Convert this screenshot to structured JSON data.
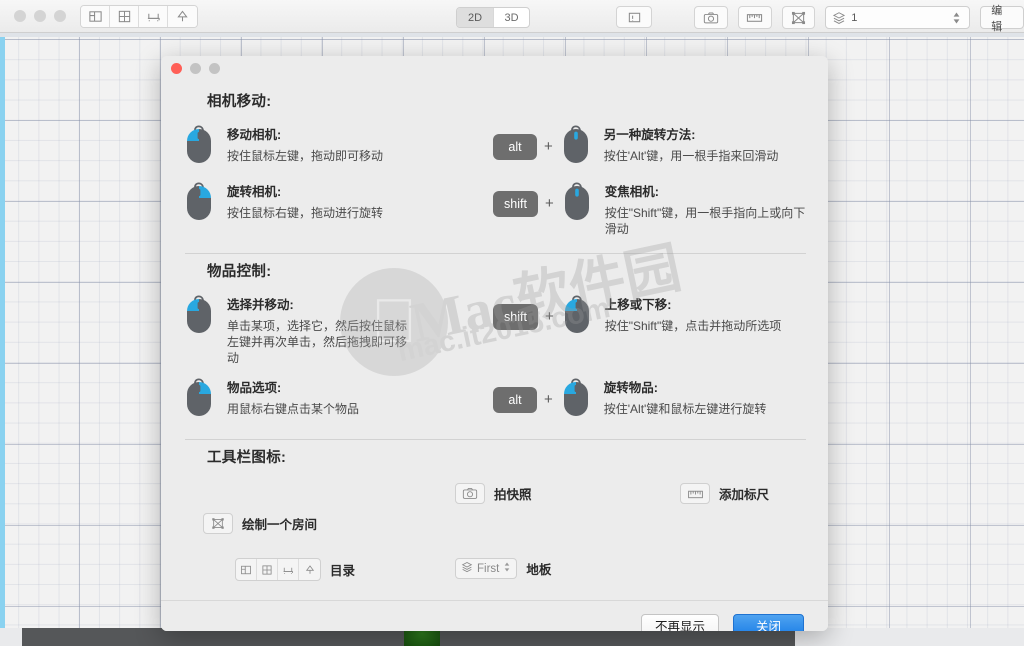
{
  "toolbar": {
    "left_icons": [
      {
        "name": "floorplan-icon",
        "label": "平面图"
      },
      {
        "name": "window-grid-icon",
        "label": "窗户"
      },
      {
        "name": "furniture-icon",
        "label": "家具"
      },
      {
        "name": "tree-icon",
        "label": "植物"
      }
    ],
    "view_modes": [
      {
        "label": "2D",
        "active": true
      },
      {
        "label": "3D",
        "active": false
      }
    ],
    "note_icon": "note-icon",
    "camera_icon": "camera-icon",
    "ruler_icon": "ruler-icon",
    "room-icon": "draw-room-icon",
    "layer_icon": "layers-icon",
    "layer_value": "1",
    "edit_label": "编辑"
  },
  "dialog": {
    "window_dots": [
      "close",
      "minimize",
      "zoom"
    ],
    "sections": [
      {
        "title": "相机移动:",
        "entries": [
          {
            "col": "left",
            "mouse": "left",
            "modifier": null,
            "title": "移动相机:",
            "desc": "按住鼠标左键，拖动即可移动"
          },
          {
            "col": "right",
            "mouse": "wheel",
            "modifier": "alt",
            "title": "另一种旋转方法:",
            "desc": "按住'Alt'键，用一根手指来回滑动"
          },
          {
            "col": "left",
            "mouse": "right",
            "modifier": null,
            "title": "旋转相机:",
            "desc": "按住鼠标右键，拖动进行旋转"
          },
          {
            "col": "right",
            "mouse": "wheel",
            "modifier": "shift",
            "title": "变焦相机:",
            "desc": "按住\"Shift\"键，用一根手指向上或向下滑动"
          }
        ]
      },
      {
        "title": "物品控制:",
        "entries": [
          {
            "col": "left",
            "mouse": "left",
            "modifier": null,
            "title": "选择并移动:",
            "desc": "单击某项，选择它，然后按住鼠标左键并再次单击，然后拖拽即可移动"
          },
          {
            "col": "right",
            "mouse": "left",
            "modifier": "shift",
            "title": "上移或下移:",
            "desc": "按住\"Shift\"键，点击并拖动所选项"
          },
          {
            "col": "left",
            "mouse": "right",
            "modifier": null,
            "title": "物品选项:",
            "desc": "用鼠标右键点击某个物品"
          },
          {
            "col": "right",
            "mouse": "left",
            "modifier": "alt",
            "title": "旋转物品:",
            "desc": "按住'Alt'键和鼠标左键进行旋转"
          }
        ]
      }
    ],
    "toolbar_icons_section": {
      "title": "工具栏图标:",
      "items": [
        {
          "icon": "draw-room-icon",
          "label": "绘制一个房间"
        },
        {
          "icon": "camera-icon",
          "label": "拍快照"
        },
        {
          "icon": "ruler-icon",
          "label": "添加标尺"
        },
        {
          "icon": "catalog-icons",
          "label": "目录"
        },
        {
          "icon": "layers-icon",
          "label": "地板",
          "select_value": "First"
        }
      ]
    },
    "footer": {
      "dont_show_label": "不再显示",
      "close_label": "关闭"
    }
  },
  "watermark": {
    "text": "Mac软件园",
    "subtext": "mac.it2015.com",
    "apple_glyph": ""
  },
  "colors": {
    "accent_blue": "#1a7de6",
    "mouse_highlight": "#29a8e0",
    "mouse_body": "#5f6368",
    "key_cap": "#6e6e6e",
    "traffic_red": "#ff5f57"
  }
}
